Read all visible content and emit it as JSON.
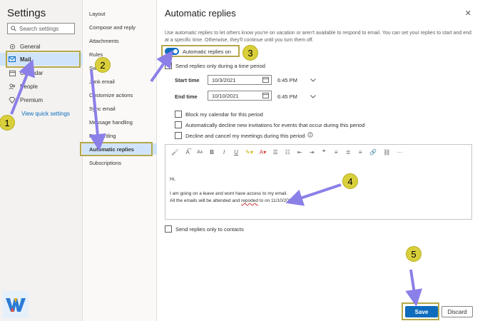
{
  "sidebar": {
    "title": "Settings",
    "search_placeholder": "Search settings",
    "items": [
      {
        "label": "General",
        "icon": "gear-icon"
      },
      {
        "label": "Mail",
        "icon": "mail-icon"
      },
      {
        "label": "Calendar",
        "icon": "calendar-icon"
      },
      {
        "label": "People",
        "icon": "people-icon"
      },
      {
        "label": "Premium",
        "icon": "diamond-icon"
      }
    ],
    "selected": "Mail",
    "quick_link": "View quick settings"
  },
  "mail_menu": {
    "items": [
      "Layout",
      "Compose and reply",
      "Attachments",
      "Rules",
      "Sweep",
      "Junk email",
      "Customize actions",
      "Sync email",
      "Message handling",
      "Forwarding",
      "Automatic replies",
      "Subscriptions"
    ],
    "selected": "Automatic replies"
  },
  "panel": {
    "title": "Automatic replies",
    "description": "Use automatic replies to let others know you're on vacation or aren't available to respond to email. You can set your replies to start and end at a specific time. Otherwise, they'll continue until you turn them off.",
    "toggle_label": "Automatic replies on",
    "toggle_on": true,
    "period_label": "Send replies only during a time period",
    "start_label": "Start time",
    "start_date": "10/3/2021",
    "start_time": "6:45 PM",
    "end_label": "End time",
    "end_date": "10/10/2021",
    "end_time": "6:45 PM",
    "options": [
      "Block my calendar for this period",
      "Automatically decline new invitations for events that occur during this period",
      "Decline and cancel my meetings during this period"
    ],
    "message_lines": [
      "Hi,",
      "I am going on a leave and wont have access to my email.",
      "All the emails will be attended and "
    ],
    "message_spell": "repoded",
    "message_tail": " to on 11/10/2021",
    "contacts_label": "Send replies only to contacts",
    "save": "Save",
    "discard": "Discard"
  },
  "annotations": [
    "1",
    "2",
    "3",
    "4",
    "5"
  ],
  "colors": {
    "accent": "#0f6cbd",
    "highlight": "#b5a84a",
    "badge": "#d8cf3b",
    "arrow": "#8b7fe8"
  }
}
